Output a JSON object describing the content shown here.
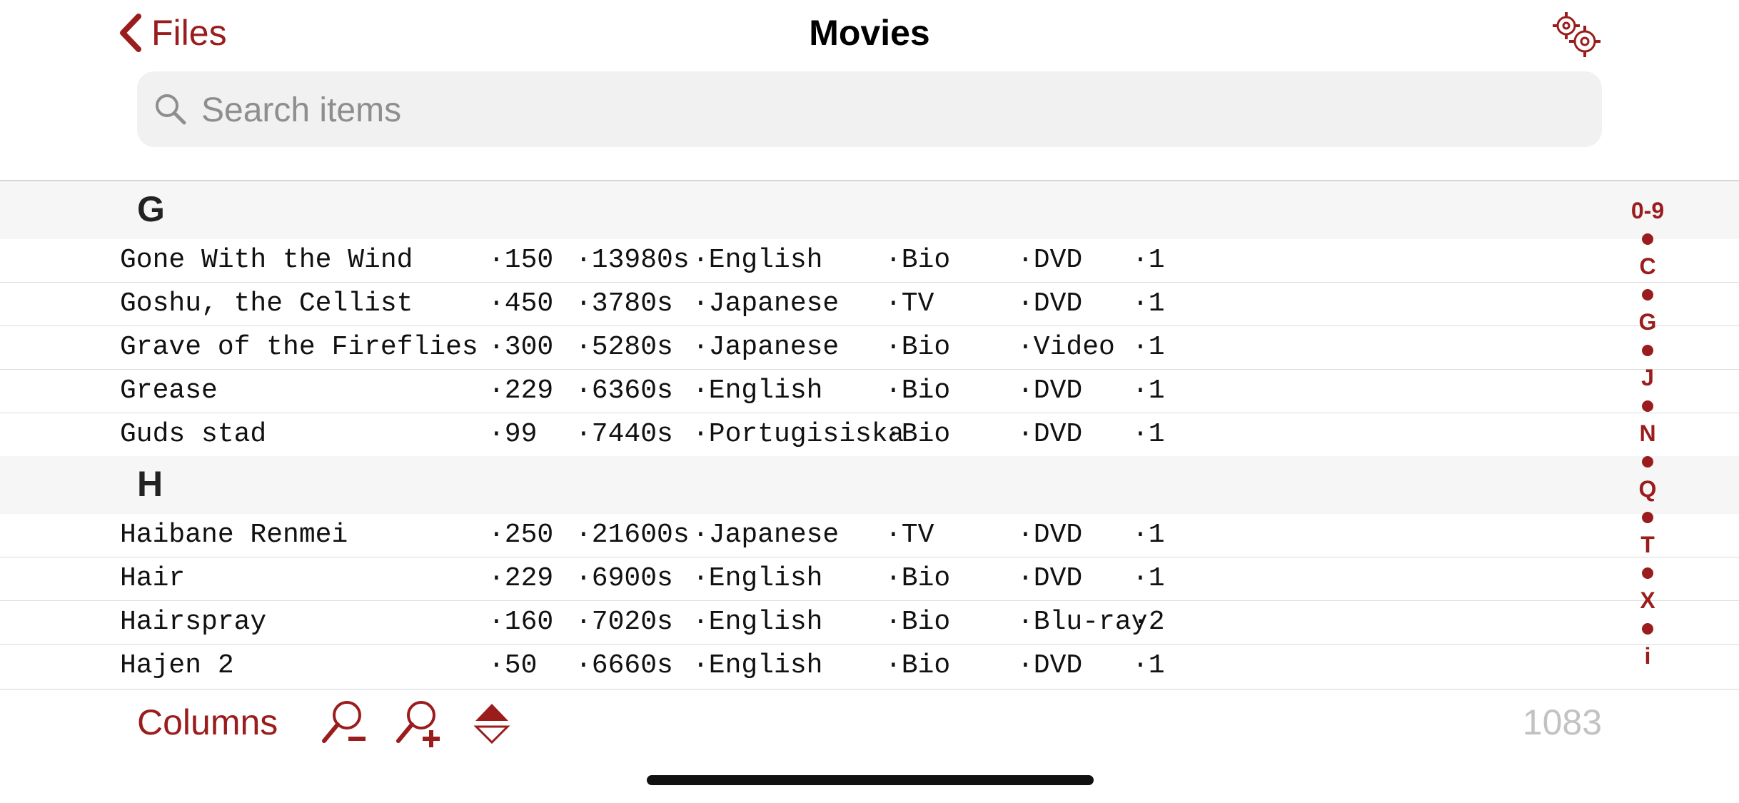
{
  "header": {
    "back_label": "Files",
    "title": "Movies",
    "settings_icon": "gears-icon"
  },
  "search": {
    "placeholder": "Search items",
    "value": ""
  },
  "sections": [
    {
      "letter": "G",
      "rows": [
        [
          "Gone With the Wind",
          "·150",
          "·13980s",
          "·English",
          "·Bio",
          "·DVD",
          "·1"
        ],
        [
          "Goshu, the Cellist",
          "·450",
          "·3780s",
          "·Japanese",
          "·TV",
          "·DVD",
          "·1"
        ],
        [
          "Grave of the Fireflies",
          "·300",
          "·5280s",
          "·Japanese",
          "·Bio",
          "·Video",
          "·1"
        ],
        [
          "Grease",
          "·229",
          "·6360s",
          "·English",
          "·Bio",
          "·DVD",
          "·1"
        ],
        [
          "Guds stad",
          "·99",
          "·7440s",
          "·Portugisiska",
          "·Bio",
          "·DVD",
          "·1"
        ]
      ]
    },
    {
      "letter": "H",
      "rows": [
        [
          "Haibane Renmei",
          "·250",
          "·21600s",
          "·Japanese",
          "·TV",
          "·DVD",
          "·1"
        ],
        [
          "Hair",
          "·229",
          "·6900s",
          "·English",
          "·Bio",
          "·DVD",
          "·1"
        ],
        [
          "Hairspray",
          "·160",
          "·7020s",
          "·English",
          "·Bio",
          "·Blu-ray",
          "·2"
        ],
        [
          "Hajen 2",
          "·50",
          "·6660s",
          "·English",
          "·Bio",
          "·DVD",
          "·1"
        ]
      ]
    }
  ],
  "index": [
    "0-9",
    "•",
    "C",
    "•",
    "G",
    "•",
    "J",
    "•",
    "N",
    "•",
    "Q",
    "•",
    "T",
    "•",
    "X",
    "•",
    "i"
  ],
  "toolbar": {
    "columns_label": "Columns",
    "zoom_out_icon": "zoom-out-icon",
    "zoom_in_icon": "zoom-in-icon",
    "sort_icon": "sort-toggle-icon",
    "count": "1083"
  },
  "colors": {
    "accent": "#9b1c1c",
    "section_bg": "#f6f6f6",
    "search_bg": "#f1f1f1",
    "count_text": "#c2c2c2"
  }
}
